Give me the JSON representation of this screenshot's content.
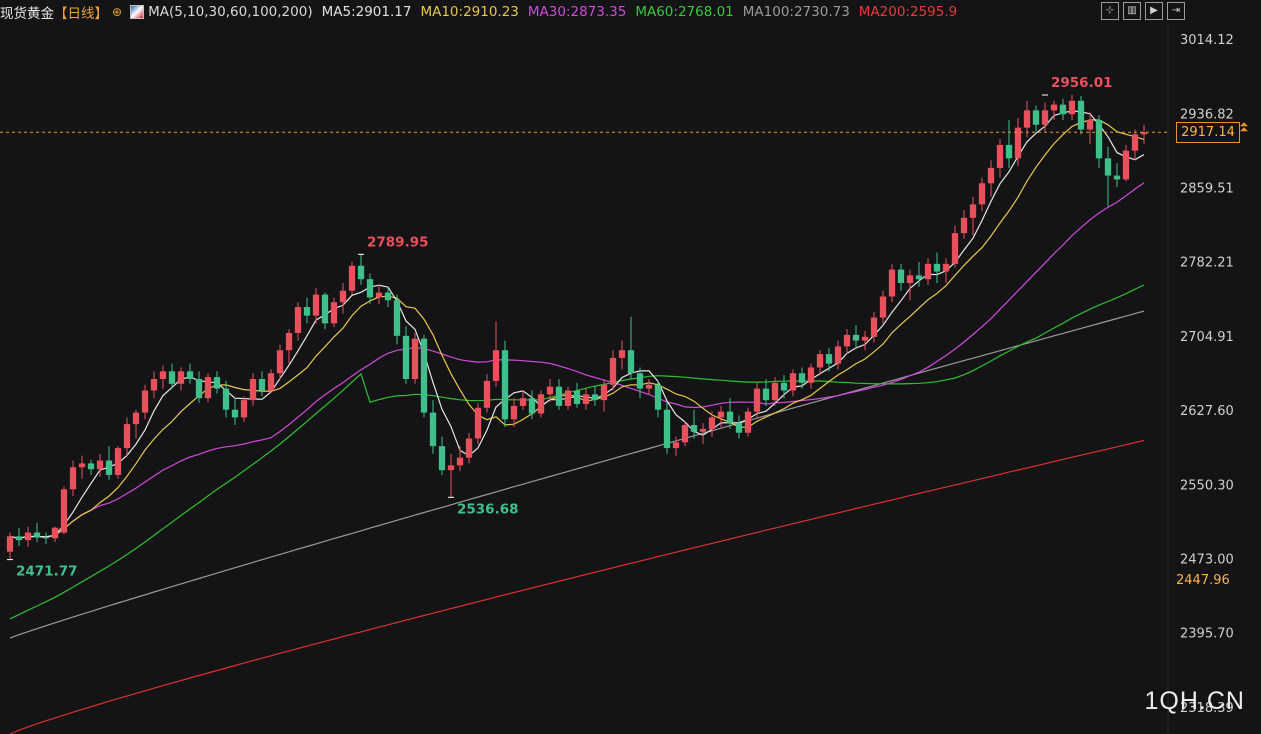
{
  "header": {
    "symbol": "现货黄金",
    "period": "【日线】",
    "settings_icon": "settings-circle-icon",
    "ma_params": "MA(5,10,30,60,100,200)",
    "ma_values": [
      {
        "text": "MA5:2901.17",
        "color": "#e0e0e0"
      },
      {
        "text": "MA10:2910.23",
        "color": "#e6c84a"
      },
      {
        "text": "MA30:2873.35",
        "color": "#d04ad8"
      },
      {
        "text": "MA60:2768.01",
        "color": "#38c838"
      },
      {
        "text": "MA100:2730.73",
        "color": "#9a9a9a"
      },
      {
        "text": "MA200:2595.9",
        "color": "#e63a3a"
      }
    ]
  },
  "toolbar": {
    "icons": [
      "crosshair-icon",
      "book-icon",
      "play-icon",
      "export-icon"
    ]
  },
  "watermark": "1QH.CN",
  "colors": {
    "up": "#e8505b",
    "down": "#3fbf8a",
    "ma5": "#e6e6e6",
    "ma10": "#e6c84a",
    "ma30": "#d04ad8",
    "ma60": "#2fbf2f",
    "ma100": "#9a9a9a",
    "ma200": "#d93030",
    "axis_text": "#d0d0d0",
    "current": "#e8952c"
  },
  "chart_data": {
    "type": "candlestick",
    "title": "现货黄金 日线",
    "y_axis_ticks": [
      "3014.12",
      "2936.82",
      "2859.51",
      "2782.21",
      "2704.91",
      "2627.60",
      "2550.30",
      "2473.00",
      "2395.70",
      "2318.39"
    ],
    "ylim": [
      2290,
      3030
    ],
    "current_price": "2917.14",
    "secondary_price_label": "2447.96",
    "annotations": [
      {
        "text": "2471.77",
        "index": 0,
        "value": 2471.77,
        "kind": "low"
      },
      {
        "text": "2789.95",
        "index": 39,
        "value": 2789.95,
        "kind": "high"
      },
      {
        "text": "2536.68",
        "index": 49,
        "value": 2536.68,
        "kind": "low"
      },
      {
        "text": "2956.01",
        "index": 115,
        "value": 2956.01,
        "kind": "high"
      }
    ],
    "candles": [
      [
        2480,
        2500,
        2471.77,
        2496
      ],
      [
        2496,
        2505,
        2486,
        2492
      ],
      [
        2492,
        2506,
        2485,
        2500
      ],
      [
        2500,
        2510,
        2490,
        2495
      ],
      [
        2495,
        2500,
        2488,
        2494
      ],
      [
        2494,
        2506,
        2490,
        2505
      ],
      [
        2500,
        2548,
        2498,
        2545
      ],
      [
        2545,
        2575,
        2538,
        2568
      ],
      [
        2568,
        2580,
        2556,
        2572
      ],
      [
        2572,
        2576,
        2560,
        2566
      ],
      [
        2566,
        2582,
        2558,
        2575
      ],
      [
        2575,
        2590,
        2555,
        2560
      ],
      [
        2560,
        2590,
        2556,
        2588
      ],
      [
        2588,
        2620,
        2580,
        2613
      ],
      [
        2613,
        2628,
        2598,
        2625
      ],
      [
        2625,
        2654,
        2618,
        2648
      ],
      [
        2648,
        2668,
        2640,
        2660
      ],
      [
        2660,
        2674,
        2650,
        2668
      ],
      [
        2668,
        2676,
        2650,
        2655
      ],
      [
        2655,
        2672,
        2648,
        2668
      ],
      [
        2668,
        2676,
        2655,
        2660
      ],
      [
        2660,
        2668,
        2635,
        2640
      ],
      [
        2640,
        2666,
        2636,
        2662
      ],
      [
        2662,
        2668,
        2645,
        2650
      ],
      [
        2650,
        2658,
        2620,
        2628
      ],
      [
        2628,
        2640,
        2612,
        2620
      ],
      [
        2620,
        2642,
        2615,
        2638
      ],
      [
        2638,
        2666,
        2632,
        2660
      ],
      [
        2660,
        2668,
        2642,
        2648
      ],
      [
        2648,
        2670,
        2645,
        2666
      ],
      [
        2666,
        2696,
        2660,
        2690
      ],
      [
        2690,
        2712,
        2676,
        2708
      ],
      [
        2708,
        2740,
        2700,
        2735
      ],
      [
        2735,
        2745,
        2718,
        2726
      ],
      [
        2726,
        2755,
        2718,
        2748
      ],
      [
        2748,
        2750,
        2712,
        2718
      ],
      [
        2718,
        2745,
        2714,
        2740
      ],
      [
        2740,
        2760,
        2728,
        2752
      ],
      [
        2752,
        2782,
        2748,
        2778
      ],
      [
        2778,
        2789.95,
        2758,
        2764
      ],
      [
        2764,
        2770,
        2738,
        2745
      ],
      [
        2745,
        2758,
        2738,
        2750
      ],
      [
        2750,
        2755,
        2735,
        2742
      ],
      [
        2742,
        2748,
        2696,
        2705
      ],
      [
        2705,
        2715,
        2655,
        2660
      ],
      [
        2660,
        2708,
        2655,
        2702
      ],
      [
        2702,
        2706,
        2620,
        2625
      ],
      [
        2625,
        2638,
        2582,
        2590
      ],
      [
        2590,
        2600,
        2560,
        2565
      ],
      [
        2565,
        2582,
        2536.68,
        2570
      ],
      [
        2570,
        2590,
        2564,
        2578
      ],
      [
        2578,
        2604,
        2572,
        2598
      ],
      [
        2598,
        2635,
        2592,
        2630
      ],
      [
        2630,
        2665,
        2625,
        2658
      ],
      [
        2658,
        2720,
        2652,
        2690
      ],
      [
        2690,
        2700,
        2610,
        2618
      ],
      [
        2618,
        2640,
        2610,
        2632
      ],
      [
        2632,
        2648,
        2628,
        2640
      ],
      [
        2640,
        2648,
        2618,
        2624
      ],
      [
        2624,
        2648,
        2620,
        2644
      ],
      [
        2644,
        2660,
        2636,
        2652
      ],
      [
        2652,
        2660,
        2628,
        2632
      ],
      [
        2632,
        2652,
        2628,
        2648
      ],
      [
        2648,
        2656,
        2630,
        2634
      ],
      [
        2634,
        2650,
        2628,
        2644
      ],
      [
        2644,
        2652,
        2632,
        2638
      ],
      [
        2638,
        2660,
        2626,
        2654
      ],
      [
        2654,
        2690,
        2648,
        2682
      ],
      [
        2682,
        2700,
        2670,
        2690
      ],
      [
        2690,
        2725,
        2660,
        2666
      ],
      [
        2666,
        2672,
        2640,
        2650
      ],
      [
        2650,
        2660,
        2644,
        2654
      ],
      [
        2654,
        2658,
        2620,
        2628
      ],
      [
        2628,
        2636,
        2582,
        2588
      ],
      [
        2588,
        2600,
        2580,
        2594
      ],
      [
        2594,
        2616,
        2590,
        2612
      ],
      [
        2612,
        2628,
        2598,
        2605
      ],
      [
        2605,
        2614,
        2592,
        2608
      ],
      [
        2608,
        2626,
        2600,
        2620
      ],
      [
        2620,
        2632,
        2610,
        2626
      ],
      [
        2626,
        2640,
        2608,
        2614
      ],
      [
        2614,
        2622,
        2598,
        2604
      ],
      [
        2604,
        2630,
        2600,
        2626
      ],
      [
        2626,
        2656,
        2620,
        2650
      ],
      [
        2650,
        2660,
        2632,
        2638
      ],
      [
        2638,
        2662,
        2632,
        2656
      ],
      [
        2656,
        2664,
        2640,
        2648
      ],
      [
        2648,
        2670,
        2642,
        2666
      ],
      [
        2666,
        2672,
        2650,
        2656
      ],
      [
        2656,
        2676,
        2650,
        2672
      ],
      [
        2672,
        2690,
        2664,
        2686
      ],
      [
        2686,
        2692,
        2668,
        2676
      ],
      [
        2676,
        2700,
        2670,
        2694
      ],
      [
        2694,
        2712,
        2686,
        2706
      ],
      [
        2706,
        2716,
        2692,
        2700
      ],
      [
        2700,
        2710,
        2690,
        2704
      ],
      [
        2704,
        2730,
        2698,
        2724
      ],
      [
        2724,
        2752,
        2718,
        2746
      ],
      [
        2746,
        2780,
        2740,
        2774
      ],
      [
        2774,
        2780,
        2752,
        2760
      ],
      [
        2760,
        2774,
        2742,
        2768
      ],
      [
        2768,
        2782,
        2756,
        2764
      ],
      [
        2764,
        2786,
        2758,
        2780
      ],
      [
        2780,
        2792,
        2760,
        2772
      ],
      [
        2772,
        2786,
        2760,
        2780
      ],
      [
        2780,
        2820,
        2776,
        2812
      ],
      [
        2812,
        2836,
        2806,
        2828
      ],
      [
        2828,
        2850,
        2810,
        2842
      ],
      [
        2842,
        2870,
        2835,
        2864
      ],
      [
        2864,
        2888,
        2850,
        2880
      ],
      [
        2880,
        2910,
        2870,
        2904
      ],
      [
        2904,
        2930,
        2880,
        2890
      ],
      [
        2890,
        2932,
        2882,
        2922
      ],
      [
        2922,
        2950,
        2912,
        2940
      ],
      [
        2940,
        2945,
        2918,
        2925
      ],
      [
        2925,
        2948,
        2918,
        2940
      ],
      [
        2940,
        2950,
        2930,
        2946
      ],
      [
        2946,
        2952,
        2930,
        2936
      ],
      [
        2936,
        2956.01,
        2930,
        2950
      ],
      [
        2950,
        2955,
        2915,
        2920
      ],
      [
        2920,
        2938,
        2905,
        2930
      ],
      [
        2930,
        2935,
        2880,
        2890
      ],
      [
        2890,
        2902,
        2840,
        2872
      ],
      [
        2872,
        2885,
        2860,
        2868
      ],
      [
        2868,
        2904,
        2866,
        2898
      ],
      [
        2898,
        2920,
        2888,
        2915
      ],
      [
        2915,
        2925,
        2905,
        2917.14
      ]
    ]
  }
}
